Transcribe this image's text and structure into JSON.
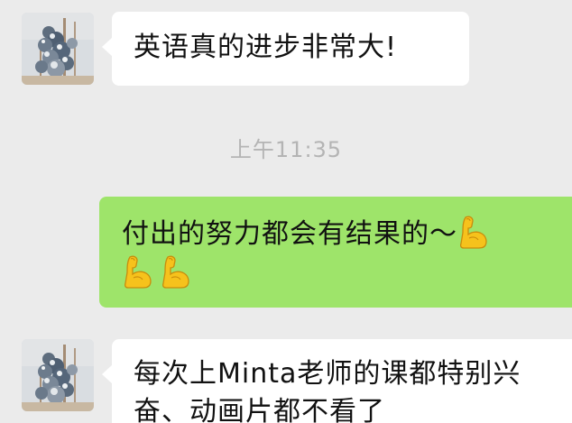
{
  "messages": [
    {
      "side": "left",
      "avatar": "frosted-tree-avatar",
      "text": "英语真的进步非常大!"
    },
    {
      "side": "right",
      "line1": "付出的努力都会有结果的～",
      "emoji": "flexed-biceps-icon",
      "emoji_count": 3
    },
    {
      "side": "left",
      "avatar": "frosted-tree-avatar",
      "line1": "每次上Minta老师的课都特别兴",
      "line2": "奋、动画片都不看了"
    }
  ],
  "timestamp": "上午11:35",
  "colors": {
    "background": "#ebebeb",
    "incoming_bubble": "#ffffff",
    "outgoing_bubble": "#9ee46a",
    "timestamp": "#b4b4b4"
  }
}
